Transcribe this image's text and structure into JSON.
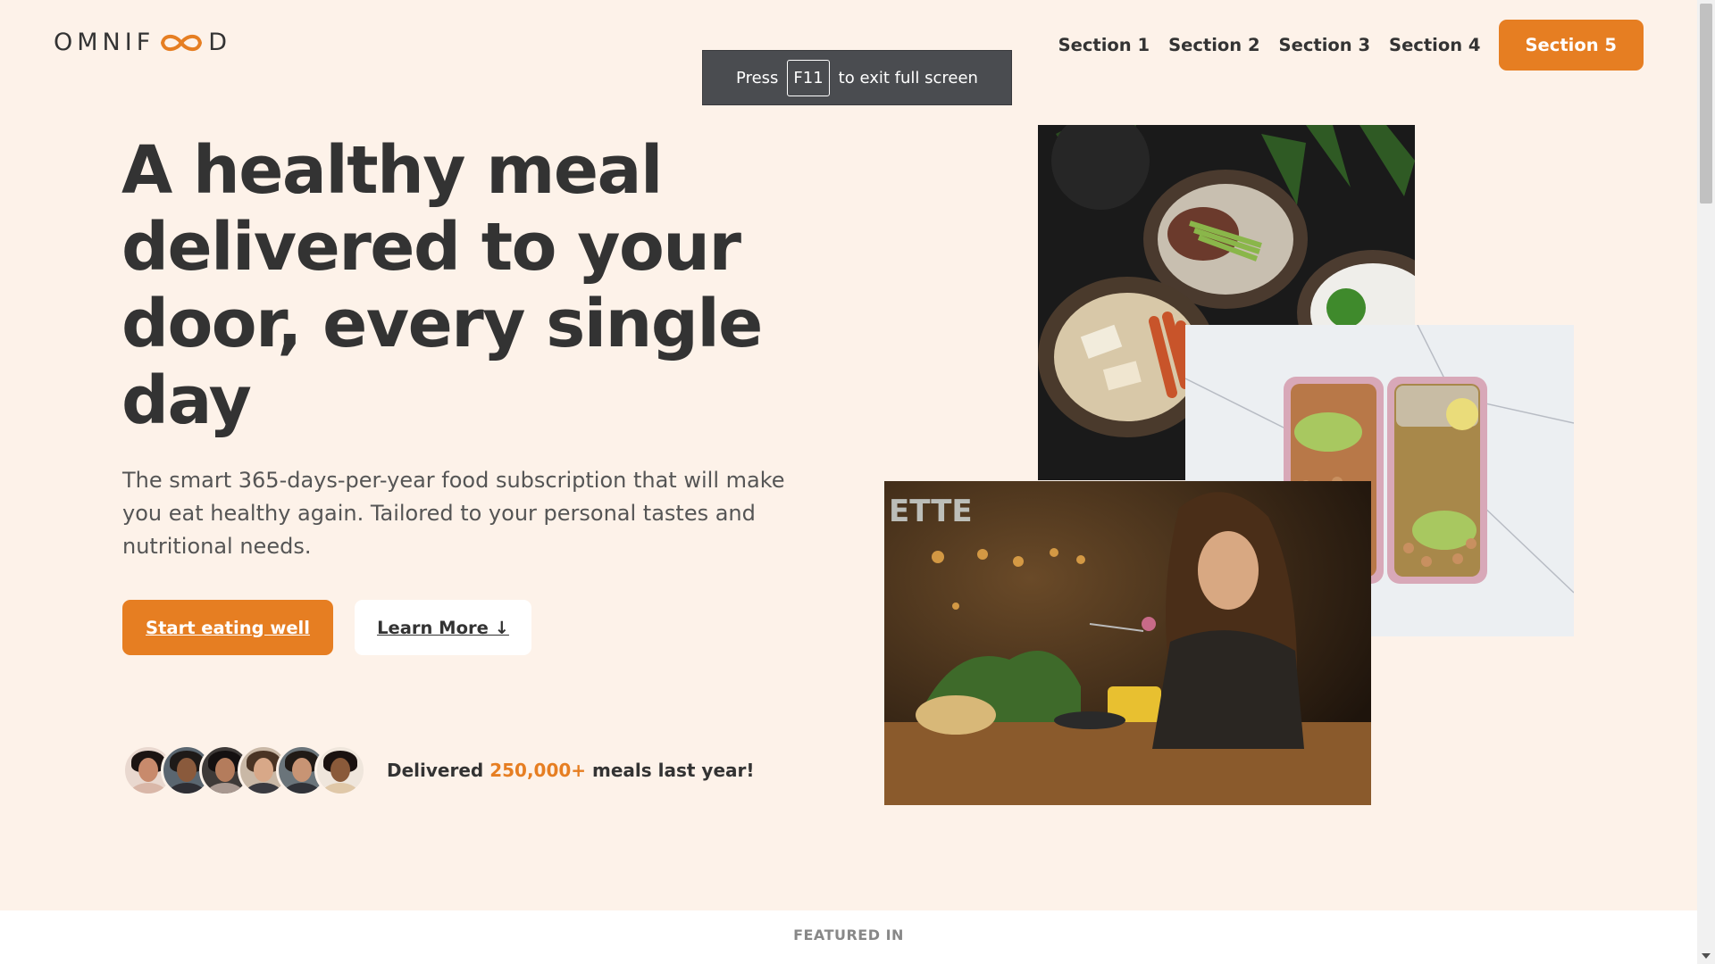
{
  "brand": {
    "logo_left": "OMNIF",
    "logo_right": "D",
    "accent": "#e67e22",
    "background": "#fdf2e9"
  },
  "nav": {
    "items": [
      "Section 1",
      "Section 2",
      "Section 3",
      "Section 4"
    ],
    "cta": "Section 5"
  },
  "fullscreen_toast": {
    "before": "Press",
    "key": "F11",
    "after": "to exit full screen"
  },
  "hero": {
    "title": "A healthy meal delivered to your door, every single day",
    "description": "The smart 365-days-per-year food subscription that will make you eat healthy again. Tailored to your personal tastes and nutritional needs.",
    "primary_button": "Start eating well",
    "secondary_button": "Learn More ↓"
  },
  "customers": {
    "prefix": "Delivered",
    "highlight": "250,000+",
    "suffix": "meals last year!",
    "avatar_count": 6
  },
  "images": {
    "bowls": "meal-bowls-photo",
    "boxes": "meal-prep-boxes-photo",
    "woman": "woman-eating-photo"
  },
  "featured": {
    "label": "FEATURED IN"
  }
}
